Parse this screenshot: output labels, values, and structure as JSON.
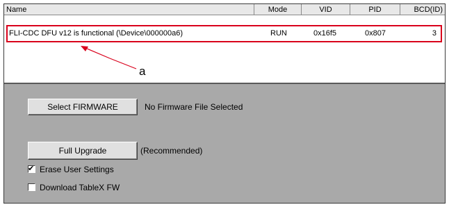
{
  "device_list": {
    "columns": {
      "name": "Name",
      "mode": "Mode",
      "vid": "VID",
      "pid": "PID",
      "bcd": "BCD(ID)"
    },
    "rows": [
      {
        "name": "FLI-CDC DFU  v12 is functional (\\Device\\000000a6)",
        "mode": "RUN",
        "vid": "0x16f5",
        "pid": "0x807",
        "bcd": "3"
      }
    ]
  },
  "annotation": {
    "label": "a",
    "color": "#d9001b"
  },
  "firmware": {
    "select_button_label": "Select FIRMWARE",
    "status_text": "No Firmware File Selected"
  },
  "upgrade": {
    "button_label": "Full Upgrade",
    "hint_text": "(Recommended)"
  },
  "options": {
    "erase_user_settings": {
      "label": "Erase User Settings",
      "checked": true
    },
    "download_tablex_fw": {
      "label": "Download TableX FW",
      "checked": false
    }
  }
}
